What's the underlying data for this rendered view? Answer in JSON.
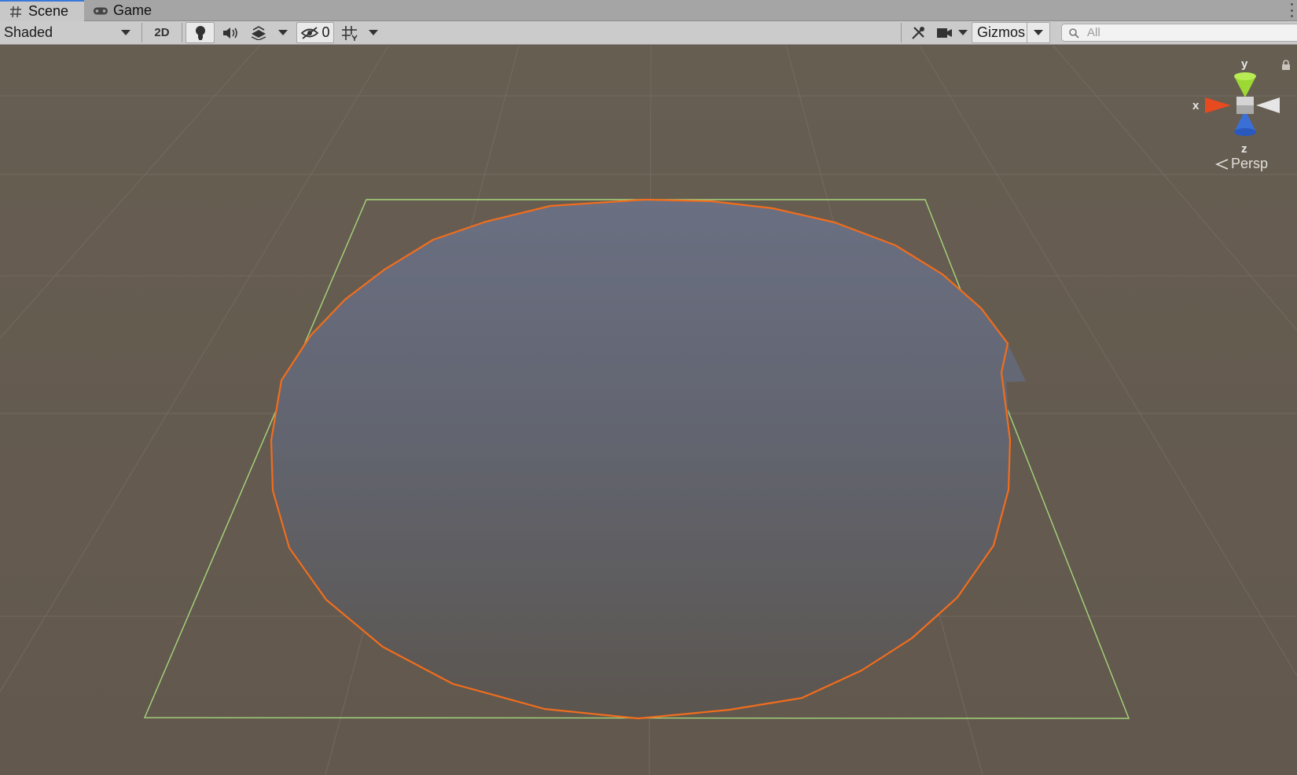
{
  "tabs": [
    {
      "label": "Scene",
      "icon": "hash-icon",
      "active": true
    },
    {
      "label": "Game",
      "icon": "gamepad-icon",
      "active": false
    }
  ],
  "toolbar": {
    "draw_mode": "Shaded",
    "mode_2d": "2D",
    "hidden_count": "0",
    "gizmos_label": "Gizmos",
    "search_placeholder": "All"
  },
  "scene_gizmo": {
    "axis_x": "x",
    "axis_y": "y",
    "axis_z": "z",
    "projection": "Persp"
  },
  "colors": {
    "selection_outline": "#f26d1c",
    "bounds_outline": "#a6d67a",
    "x_axis": "#e84a1f",
    "y_axis": "#9dd834",
    "z_axis": "#3a6fd8",
    "viewport_bg": "#655b50"
  },
  "icons": [
    "hash-icon",
    "gamepad-icon",
    "dropdown-caret-icon",
    "lightbulb-icon",
    "audio-icon",
    "effects-icon",
    "hidden-objects-icon",
    "grid-icon",
    "tools-icon",
    "camera-icon",
    "search-icon",
    "lock-icon",
    "menu-kebab-icon"
  ]
}
